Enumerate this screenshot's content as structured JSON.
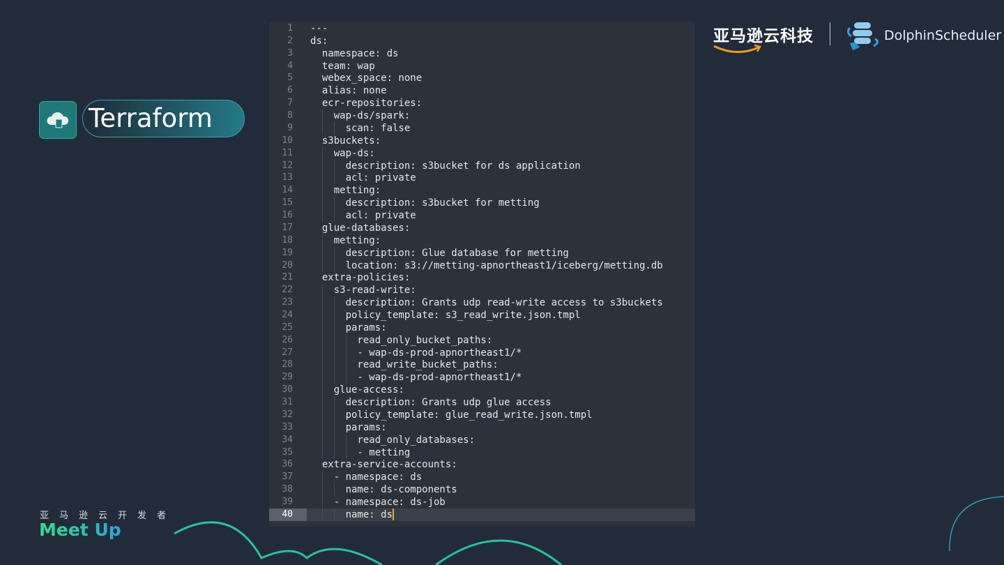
{
  "section": {
    "title": "Terraform"
  },
  "brand": {
    "cn_logo": "亚马逊云科技",
    "ds_logo": "DolphinScheduler",
    "meetup_cn": "亚马逊云开发者",
    "meetup": "Meet Up"
  },
  "editor": {
    "active_line": 40,
    "lines": [
      "---",
      "ds:",
      "  namespace: ds",
      "  team: wap",
      "  webex_space: none",
      "  alias: none",
      "  ecr-repositories:",
      "    wap-ds/spark:",
      "      scan: false",
      "  s3buckets:",
      "    wap-ds:",
      "      description: s3bucket for ds application",
      "      acl: private",
      "    metting:",
      "      description: s3bucket for metting",
      "      acl: private",
      "  glue-databases:",
      "    metting:",
      "      description: Glue database for metting",
      "      location: s3://metting-apnortheast1/iceberg/metting.db",
      "  extra-policies:",
      "    s3-read-write:",
      "      description: Grants udp read-write access to s3buckets",
      "      policy_template: s3_read_write.json.tmpl",
      "      params:",
      "        read_only_bucket_paths:",
      "        - wap-ds-prod-apnortheast1/*",
      "        read_write_bucket_paths:",
      "        - wap-ds-prod-apnortheast1/*",
      "    glue-access:",
      "      description: Grants udp glue access",
      "      policy_template: glue_read_write.json.tmpl",
      "      params:",
      "        read_only_databases:",
      "        - metting",
      "  extra-service-accounts:",
      "    - namespace: ds",
      "      name: ds-components",
      "    - namespace: ds-job",
      "      name: ds"
    ]
  }
}
